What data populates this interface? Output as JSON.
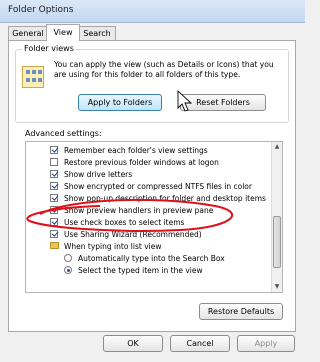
{
  "window": {
    "title": "Folder Options"
  },
  "tabs": [
    {
      "label": "General"
    },
    {
      "label": "View"
    },
    {
      "label": "Search"
    }
  ],
  "folder_views": {
    "label": "Folder views",
    "description": "You can apply the view (such as Details or Icons) that you are using for this folder to all folders of this type.",
    "apply_button": "Apply to Folders",
    "reset_button": "Reset Folders"
  },
  "advanced": {
    "label": "Advanced settings:",
    "items": [
      {
        "type": "checkbox",
        "checked": true,
        "label": "Remember each folder's view settings"
      },
      {
        "type": "checkbox",
        "checked": false,
        "label": "Restore previous folder windows at logon"
      },
      {
        "type": "checkbox",
        "checked": true,
        "label": "Show drive letters"
      },
      {
        "type": "checkbox",
        "checked": true,
        "label": "Show encrypted or compressed NTFS files in color"
      },
      {
        "type": "checkbox",
        "checked": true,
        "label": "Show pop-up description for folder and desktop items"
      },
      {
        "type": "checkbox",
        "checked": true,
        "label": "Show preview handlers in preview pane"
      },
      {
        "type": "checkbox",
        "checked": true,
        "label": "Use check boxes to select items"
      },
      {
        "type": "checkbox",
        "checked": true,
        "label": "Use Sharing Wizard (Recommended)"
      },
      {
        "type": "folder",
        "label": "When typing into list view"
      },
      {
        "type": "radio",
        "checked": false,
        "label": "Automatically type into the Search Box"
      },
      {
        "type": "radio",
        "checked": true,
        "label": "Select the typed item in the view"
      }
    ],
    "restore_button": "Restore Defaults"
  },
  "footer": {
    "ok": "OK",
    "cancel": "Cancel",
    "apply": "Apply"
  },
  "colors": {
    "annotation": "#e0101a",
    "accent": "#3c7fb1"
  }
}
